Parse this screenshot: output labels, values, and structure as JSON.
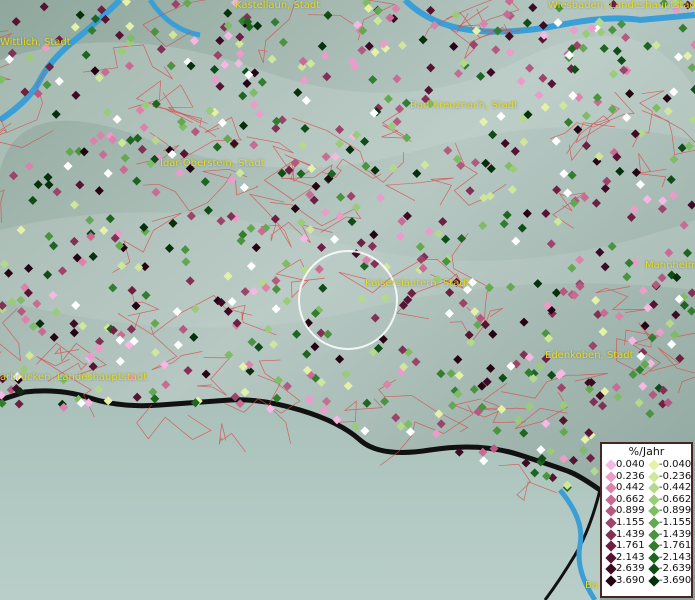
{
  "cities": [
    {
      "name": "Kastellaun, Stadt",
      "pos": [
        235,
        0
      ]
    },
    {
      "name": "Wiesbaden, Landeshauptstadt",
      "pos": [
        548,
        0
      ]
    },
    {
      "name": "Wittlich, Stadt",
      "pos": [
        0,
        37
      ]
    },
    {
      "name": "Bad Kreuznach, Stadt",
      "pos": [
        410,
        100
      ]
    },
    {
      "name": "Idar-Oberstein, Stadt",
      "pos": [
        160,
        158
      ]
    },
    {
      "name": "Kaiserslautern, Stadt",
      "pos": [
        365,
        278
      ]
    },
    {
      "name": "Mannheim",
      "pos": [
        645,
        260
      ]
    },
    {
      "name": "Edenkoben, Stadt",
      "pos": [
        545,
        350
      ]
    },
    {
      "name": "arbrücken, Landeshauptstadt",
      "pos": [
        0,
        372
      ]
    },
    {
      "name": "Ba",
      "pos": [
        585,
        580
      ]
    }
  ],
  "legend": {
    "title": "%/Jahr",
    "rows": [
      {
        "pos_value": "0.040",
        "pos_color": "#f5b7e4",
        "neg_value": "-0.040",
        "neg_color": "#e4f2a8"
      },
      {
        "pos_value": "0.236",
        "pos_color": "#ec9cc9",
        "neg_value": "-0.236",
        "neg_color": "#cfe79a"
      },
      {
        "pos_value": "0.442",
        "pos_color": "#dc83ac",
        "neg_value": "-0.442",
        "neg_color": "#b5d98a"
      },
      {
        "pos_value": "0.662",
        "pos_color": "#c96c94",
        "neg_value": "-0.662",
        "neg_color": "#9acb78"
      },
      {
        "pos_value": "0.899",
        "pos_color": "#b4597f",
        "neg_value": "-0.899",
        "neg_color": "#7fbc66"
      },
      {
        "pos_value": "1.155",
        "pos_color": "#9c4469",
        "neg_value": "-1.155",
        "neg_color": "#64a851"
      },
      {
        "pos_value": "1.439",
        "pos_color": "#833055",
        "neg_value": "-1.439",
        "neg_color": "#4a933f"
      },
      {
        "pos_value": "1.761",
        "pos_color": "#6d2042",
        "neg_value": "-1.761",
        "neg_color": "#337d2f"
      },
      {
        "pos_value": "2.143",
        "pos_color": "#561433",
        "neg_value": "-2.143",
        "neg_color": "#1f6522"
      },
      {
        "pos_value": "2.639",
        "pos_color": "#3e0b24",
        "neg_value": "-2.639",
        "neg_color": "#104d16"
      },
      {
        "pos_value": "3.690",
        "pos_color": "#250414",
        "neg_value": "-3.690",
        "neg_color": "#06300b"
      }
    ]
  },
  "colors": {
    "white_point": "#ffffff",
    "boundary": "#d94848",
    "river": "#3a9fd6",
    "border": "#111111"
  }
}
